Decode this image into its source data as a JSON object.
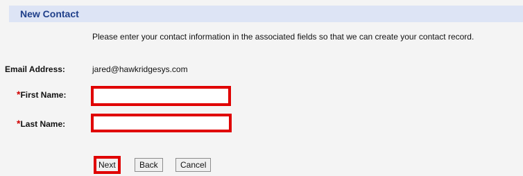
{
  "form": {
    "title": "New Contact",
    "intro": "Please enter your contact information in the associated fields so that we can create your contact record.",
    "email_label": "Email Address:",
    "email_value": "jared@hawkridgesys.com",
    "required_marker": "*",
    "first_name_label": "First Name:",
    "first_name_value": "",
    "last_name_label": "Last Name:",
    "last_name_value": ""
  },
  "buttons": {
    "next": "Next",
    "back": "Back",
    "cancel": "Cancel"
  },
  "colors": {
    "header_bg": "#dde4f5",
    "title": "#1f3f8a",
    "highlight_border": "#e00000",
    "required": "#d00000"
  }
}
